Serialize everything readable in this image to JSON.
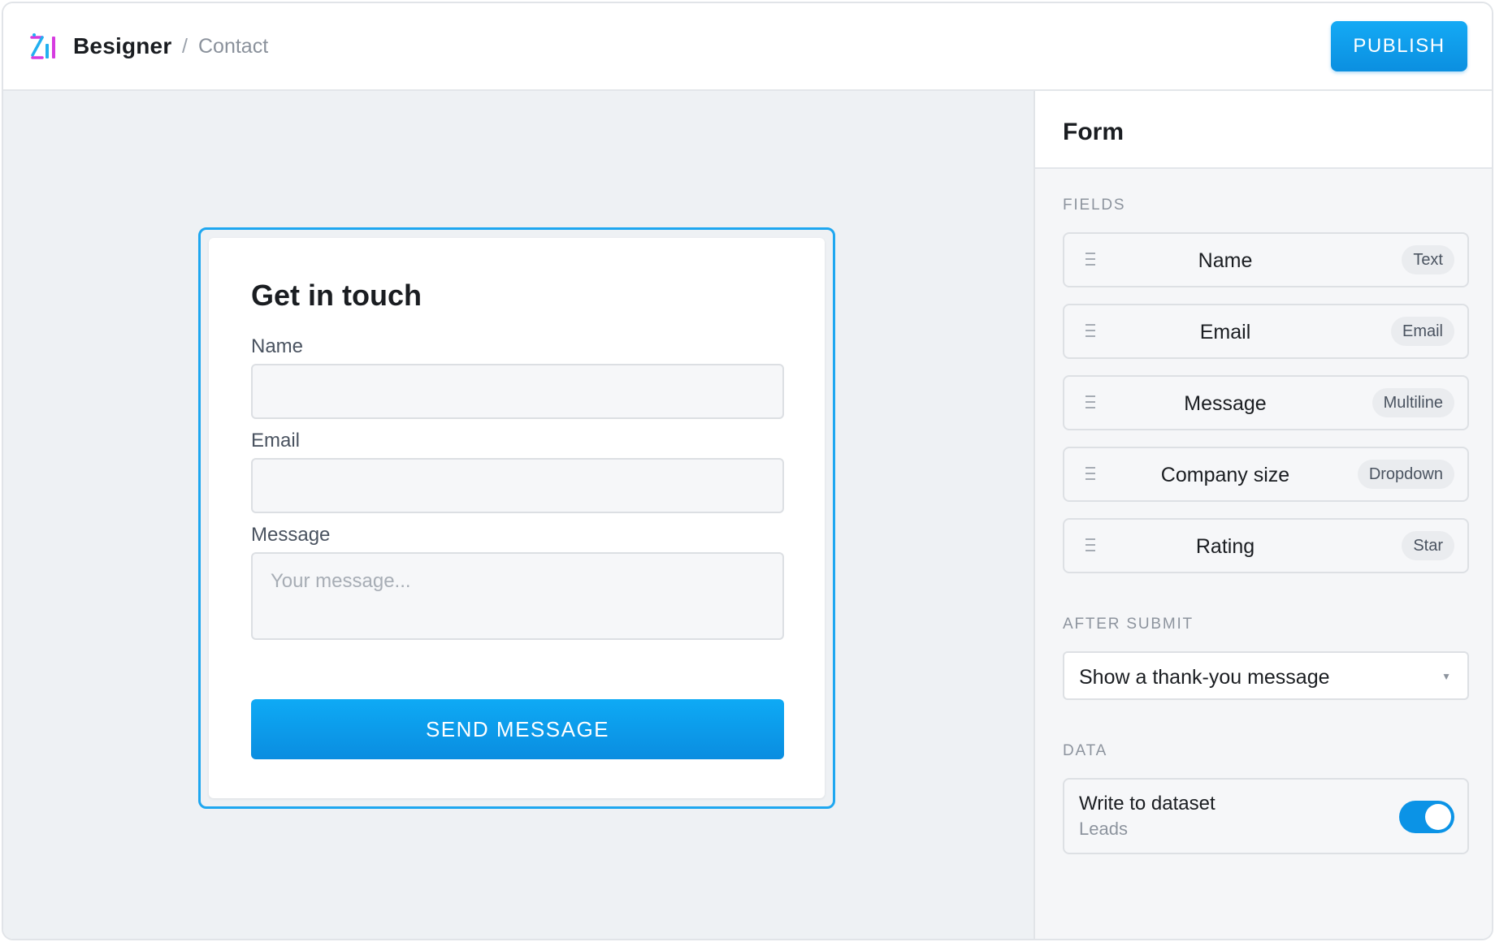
{
  "header": {
    "app_name": "Besigner",
    "breadcrumb_separator": "/",
    "breadcrumb_page": "Contact",
    "publish_label": "PUBLISH",
    "logo_icon": "besigner-logo-icon"
  },
  "canvas": {
    "form": {
      "title": "Get in touch",
      "fields": [
        {
          "label": "Name",
          "value": ""
        },
        {
          "label": "Email",
          "value": ""
        },
        {
          "label": "Message",
          "placeholder": "Your message..."
        }
      ],
      "submit_label": "SEND MESSAGE"
    }
  },
  "panel": {
    "title": "Form",
    "fields_section": "FIELDS",
    "fields": [
      {
        "label": "Name",
        "type": "Text"
      },
      {
        "label": "Email",
        "type": "Email"
      },
      {
        "label": "Message",
        "type": "Multiline"
      },
      {
        "label": "Company size",
        "type": "Dropdown"
      },
      {
        "label": "Rating",
        "type": "Star"
      }
    ],
    "after_submit_section": "AFTER SUBMIT",
    "after_submit_value": "Show a thank-you message",
    "data_section": "DATA",
    "data_title": "Write to dataset",
    "data_dataset": "Leads",
    "data_toggle_on": true
  },
  "colors": {
    "accent": "#0b93e6",
    "canvas_bg": "#eef1f4",
    "selection": "#1ea7f0",
    "logo_blue": "#22b0f0",
    "logo_magenta": "#d63be0"
  }
}
